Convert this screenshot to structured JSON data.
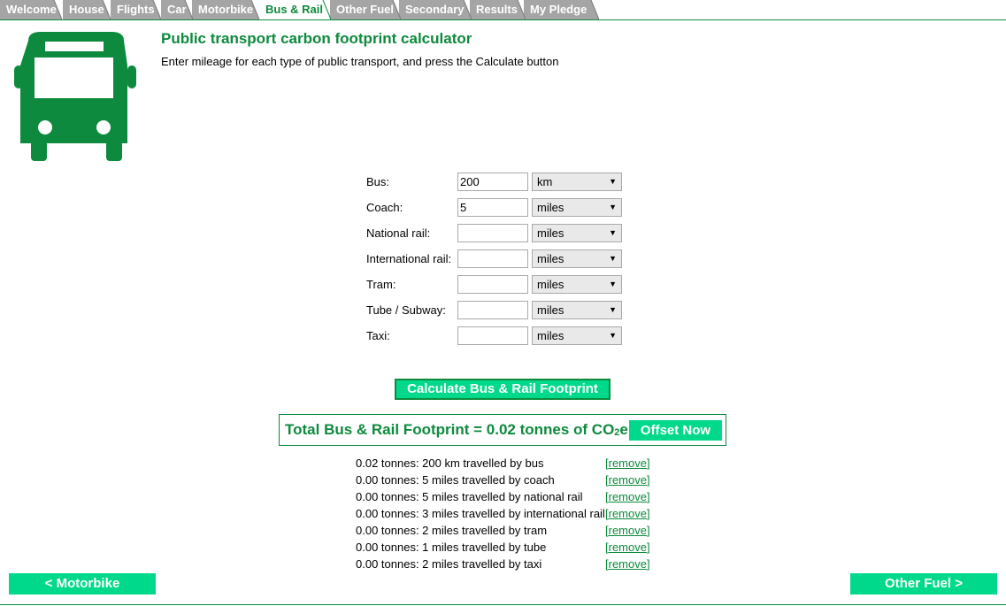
{
  "tabs": [
    {
      "label": "Welcome",
      "active": false
    },
    {
      "label": "House",
      "active": false
    },
    {
      "label": "Flights",
      "active": false
    },
    {
      "label": "Car",
      "active": false
    },
    {
      "label": "Motorbike",
      "active": false
    },
    {
      "label": "Bus & Rail",
      "active": true
    },
    {
      "label": "Other Fuel",
      "active": false
    },
    {
      "label": "Secondary",
      "active": false
    },
    {
      "label": "Results",
      "active": false
    },
    {
      "label": "My Pledge",
      "active": false
    }
  ],
  "header": {
    "icon": "bus-icon",
    "title": "Public transport carbon footprint calculator",
    "subtitle": "Enter mileage for each type of public transport, and press the Calculate button"
  },
  "form": {
    "rows": [
      {
        "label": "Bus:",
        "value": "200",
        "unit": "km"
      },
      {
        "label": "Coach:",
        "value": "5",
        "unit": "miles"
      },
      {
        "label": "National rail:",
        "value": "",
        "unit": "miles"
      },
      {
        "label": "International rail:",
        "value": "",
        "unit": "miles"
      },
      {
        "label": "Tram:",
        "value": "",
        "unit": "miles"
      },
      {
        "label": "Tube / Subway:",
        "value": "",
        "unit": "miles"
      },
      {
        "label": "Taxi:",
        "value": "",
        "unit": "miles"
      }
    ],
    "calculate_label": "Calculate Bus & Rail Footprint"
  },
  "total": {
    "prefix": "Total Bus & Rail Footprint = 0.02 tonnes of CO",
    "sub": "2",
    "suffix": "e",
    "offset_label": "Offset Now"
  },
  "results": [
    {
      "text": "0.02 tonnes: 200 km travelled by bus",
      "remove": "[remove]"
    },
    {
      "text": "0.00 tonnes: 5 miles travelled by coach",
      "remove": "[remove]"
    },
    {
      "text": "0.00 tonnes: 5 miles travelled by national rail",
      "remove": "[remove]"
    },
    {
      "text": "0.00 tonnes: 3 miles travelled by international rail",
      "remove": "[remove]"
    },
    {
      "text": "0.00 tonnes: 2 miles travelled by tram",
      "remove": "[remove]"
    },
    {
      "text": "0.00 tonnes: 1 miles travelled by tube",
      "remove": "[remove]"
    },
    {
      "text": "0.00 tonnes: 2 miles travelled by taxi",
      "remove": "[remove]"
    }
  ],
  "nav": {
    "prev_label": "< Motorbike",
    "next_label": "Other Fuel >"
  },
  "colors": {
    "brand_green": "#0d8a3d",
    "button_green": "#00d98b",
    "tab_gray": "#a5a5a5"
  }
}
